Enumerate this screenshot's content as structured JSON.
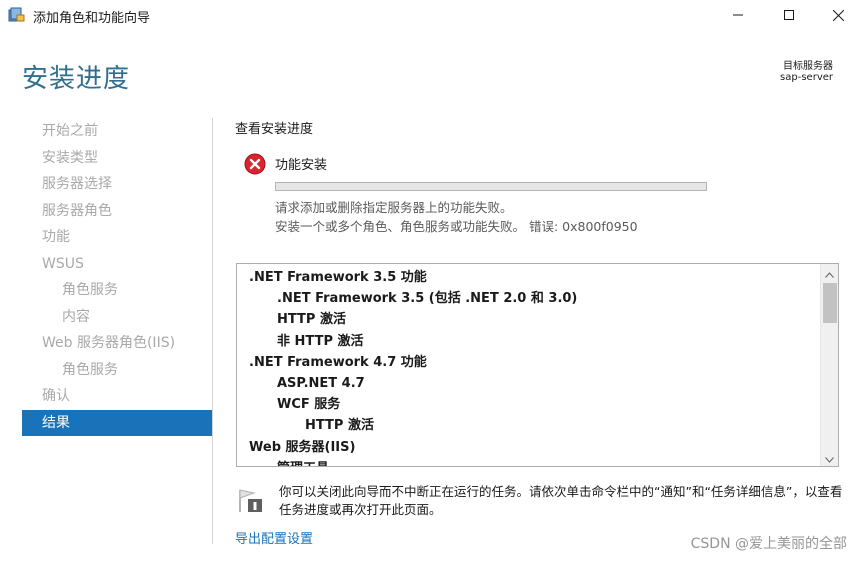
{
  "window": {
    "title": "添加角色和功能向导",
    "app_icon": "server-manager-icon",
    "buttons": {
      "minimize": "minimize-icon",
      "maximize": "maximize-icon",
      "close": "close-icon"
    }
  },
  "header": {
    "page_title": "安装进度",
    "destination_label": "目标服务器",
    "destination_value": "sap-server"
  },
  "nav": {
    "items": [
      {
        "label": "开始之前",
        "level": 0,
        "active": false
      },
      {
        "label": "安装类型",
        "level": 0,
        "active": false
      },
      {
        "label": "服务器选择",
        "level": 0,
        "active": false
      },
      {
        "label": "服务器角色",
        "level": 0,
        "active": false
      },
      {
        "label": "功能",
        "level": 0,
        "active": false
      },
      {
        "label": "WSUS",
        "level": 0,
        "active": false
      },
      {
        "label": "角色服务",
        "level": 1,
        "active": false
      },
      {
        "label": "内容",
        "level": 1,
        "active": false
      },
      {
        "label": "Web 服务器角色(IIS)",
        "level": 0,
        "active": false
      },
      {
        "label": "角色服务",
        "level": 1,
        "active": false
      },
      {
        "label": "确认",
        "level": 0,
        "active": false
      },
      {
        "label": "结果",
        "level": 0,
        "active": true
      }
    ],
    "active_color": "#1a73b9"
  },
  "main": {
    "section_heading": "查看安装进度",
    "status": {
      "icon": "error-icon",
      "title": "功能安装",
      "progress_percent": 0,
      "message_1": "请求添加或删除指定服务器上的功能失败。",
      "message_2": "安装一个或多个角色、角色服务或功能失败。 错误: 0x800f0950"
    },
    "features": [
      {
        "label": ".NET Framework 3.5 功能",
        "level": 0
      },
      {
        "label": ".NET Framework 3.5 (包括 .NET 2.0 和 3.0)",
        "level": 1
      },
      {
        "label": "HTTP 激活",
        "level": 1
      },
      {
        "label": "非 HTTP 激活",
        "level": 1
      },
      {
        "label": ".NET Framework 4.7 功能",
        "level": 0
      },
      {
        "label": "ASP.NET 4.7",
        "level": 1
      },
      {
        "label": "WCF 服务",
        "level": 1
      },
      {
        "label": "HTTP 激活",
        "level": 2
      },
      {
        "label": "Web 服务器(IIS)",
        "level": 0
      },
      {
        "label": "管理工具",
        "level": 1
      }
    ],
    "note_icon": "flag-notification-icon",
    "note_text": "你可以关闭此向导而不中断正在运行的任务。请依次单击命令栏中的“通知”和“任务详细信息”，以查看任务进度或再次打开此页面。",
    "export_link": "导出配置设置"
  },
  "watermark": "CSDN @爱上美丽的全部",
  "colors": {
    "accent": "#1a73b9",
    "title": "#2f6f8f",
    "error": "#d9232e"
  }
}
